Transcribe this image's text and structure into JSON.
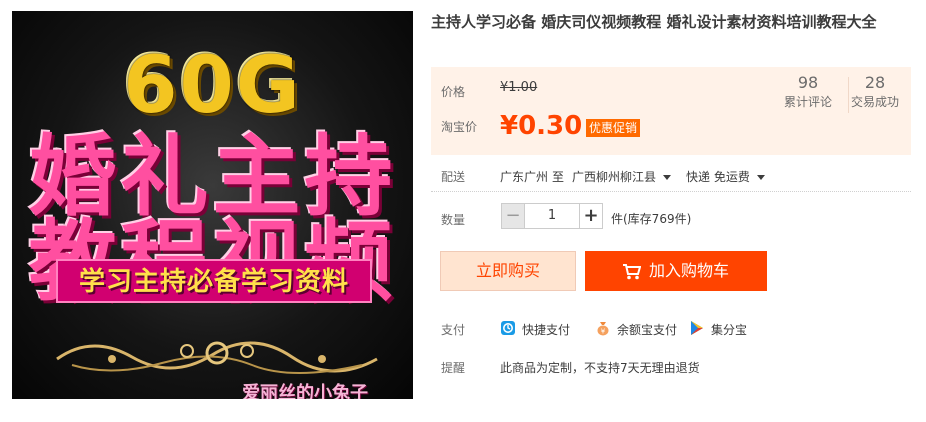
{
  "product": {
    "title": "主持人学习必备 婚庆司仪视频教程 婚礼设计素材资料培训教程大全",
    "image": {
      "headline": "60G",
      "line1": "婚礼主持",
      "line2": "教程视频",
      "banner": "学习主持必备学习资料",
      "watermark": "爱丽丝的小兔子"
    }
  },
  "price": {
    "label": "价格",
    "original": "¥1.00",
    "taobao_label": "淘宝价",
    "current": "¥0.30",
    "promo_badge": "优惠促销"
  },
  "stats": {
    "reviews_count": "98",
    "reviews_label": "累计评论",
    "sales_count": "28",
    "sales_label": "交易成功"
  },
  "shipping": {
    "label": "配送",
    "from": "广东广州",
    "to_word": "至",
    "destination": "广西柳州柳江县",
    "method": "快递 免运费"
  },
  "quantity": {
    "label": "数量",
    "minus": "−",
    "value": "1",
    "plus": "+",
    "stock": "件(库存769件)"
  },
  "actions": {
    "buy_now": "立即购买",
    "add_to_cart": "加入购物车"
  },
  "payment": {
    "label": "支付",
    "methods": [
      "快捷支付",
      "余额宝支付",
      "集分宝"
    ]
  },
  "reminder": {
    "label": "提醒",
    "text": "此商品为定制，不支持7天无理由退货"
  },
  "colors": {
    "accent": "#ff4400",
    "price_panel_bg": "#fff2e8",
    "buy_now_bg": "#ffe4d0"
  }
}
